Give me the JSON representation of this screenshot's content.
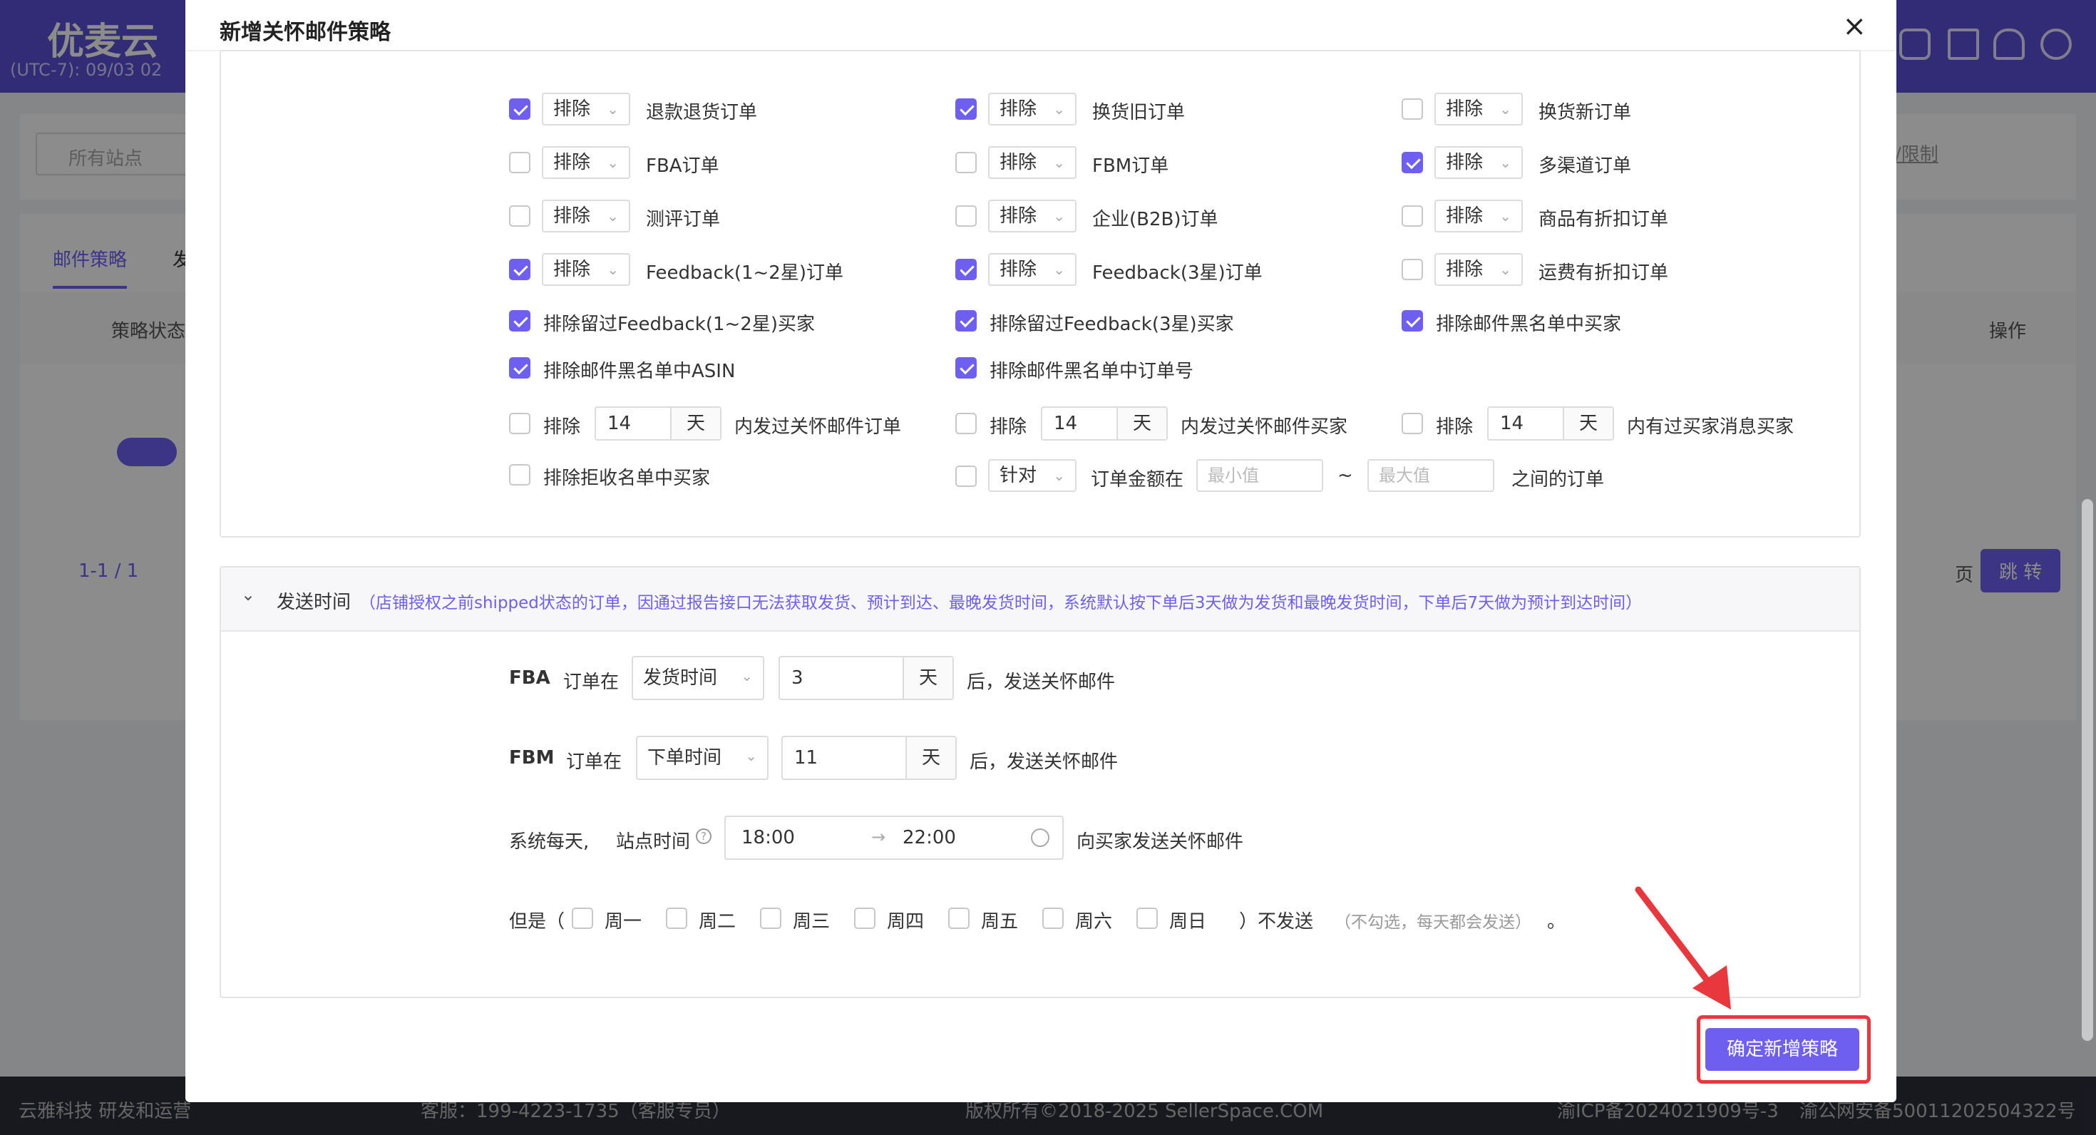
{
  "app": {
    "logo": "优麦云",
    "timezone": "(UTC-7): 09/03 02",
    "site_filter_placeholder": "所有站点",
    "tabs": [
      "邮件策略",
      "发"
    ],
    "columns": {
      "status": "策略状态",
      "ops": "操作"
    },
    "pagination": "1-1 / 1",
    "page_label": "页",
    "jump_button": "跳 转",
    "limit_link": "/限制"
  },
  "footer": {
    "company": "云雅科技 研发和运营",
    "service": "客服：199-4223-1735（客服专员）",
    "copyright": "版权所有©2018-2025 SellerSpace.COM",
    "icp": "渝ICP备2024021909号-3",
    "police": "渝公网安备50011202504322号"
  },
  "modal": {
    "title": "新增关怀邮件策略",
    "close_label": "×",
    "filters": {
      "select_default": "排除",
      "rows": [
        {
          "col1": {
            "checked": true,
            "label": "退款退货订单"
          },
          "col2": {
            "checked": true,
            "label": "换货旧订单"
          },
          "col3": {
            "checked": false,
            "label": "换货新订单"
          }
        },
        {
          "col1": {
            "checked": false,
            "label": "FBA订单"
          },
          "col2": {
            "checked": false,
            "label": "FBM订单"
          },
          "col3": {
            "checked": true,
            "label": "多渠道订单"
          }
        },
        {
          "col1": {
            "checked": false,
            "label": "测评订单"
          },
          "col2": {
            "checked": false,
            "label": "企业(B2B)订单"
          },
          "col3": {
            "checked": false,
            "label": "商品有折扣订单"
          }
        },
        {
          "col1": {
            "checked": true,
            "label": "Feedback(1~2星)订单"
          },
          "col2": {
            "checked": true,
            "label": "Feedback(3星)订单"
          },
          "col3": {
            "checked": false,
            "label": "运费有折扣订单"
          }
        }
      ],
      "plain_rows": [
        {
          "col1": {
            "checked": true,
            "label": "排除留过Feedback(1~2星)买家"
          },
          "col2": {
            "checked": true,
            "label": "排除留过Feedback(3星)买家"
          },
          "col3": {
            "checked": true,
            "label": "排除邮件黑名单中买家"
          }
        },
        {
          "col1": {
            "checked": true,
            "label": "排除邮件黑名单中ASIN"
          },
          "col2": {
            "checked": true,
            "label": "排除邮件黑名单中订单号"
          }
        }
      ],
      "day_rows": [
        {
          "checked": false,
          "prefix": "排除",
          "value": "14",
          "unit": "天",
          "suffix": "内发过关怀邮件订单"
        },
        {
          "checked": false,
          "prefix": "排除",
          "value": "14",
          "unit": "天",
          "suffix": "内发过关怀邮件买家"
        },
        {
          "checked": false,
          "prefix": "排除",
          "value": "14",
          "unit": "天",
          "suffix": "内有过买家消息买家"
        }
      ],
      "reject_list": {
        "checked": false,
        "label": "排除拒收名单中买家"
      },
      "amount": {
        "checked": false,
        "select": "针对",
        "label": "订单金额在",
        "min_placeholder": "最小值",
        "tilde": "~",
        "max_placeholder": "最大值",
        "suffix": "之间的订单"
      }
    },
    "send_time": {
      "title": "发送时间",
      "note": "（店铺授权之前shipped状态的订单，因通过报告接口无法获取发货、预计到达、最晚发货时间，系统默认按下单后3天做为发货和最晚发货时间，下单后7天做为预计到达时间）",
      "fba": {
        "label": "FBA",
        "order_in": "订单在",
        "select": "发货时间",
        "value": "3",
        "unit": "天",
        "suffix": "后，发送关怀邮件"
      },
      "fbm": {
        "label": "FBM",
        "order_in": "订单在",
        "select": "下单时间",
        "value": "11",
        "unit": "天",
        "suffix": "后，发送关怀邮件"
      },
      "daily": {
        "label": "系统每天,",
        "site_time": "站点时间",
        "start": "18:00",
        "arrow": "→",
        "end": "22:00",
        "suffix": "向买家发送关怀邮件"
      },
      "except": {
        "prefix": "但是（",
        "days": [
          "周一",
          "周二",
          "周三",
          "周四",
          "周五",
          "周六",
          "周日"
        ],
        "suffix": "）不发送",
        "hint": "（不勾选，每天都会发送）",
        "period": "。"
      }
    },
    "confirm_button": "确定新增策略"
  }
}
